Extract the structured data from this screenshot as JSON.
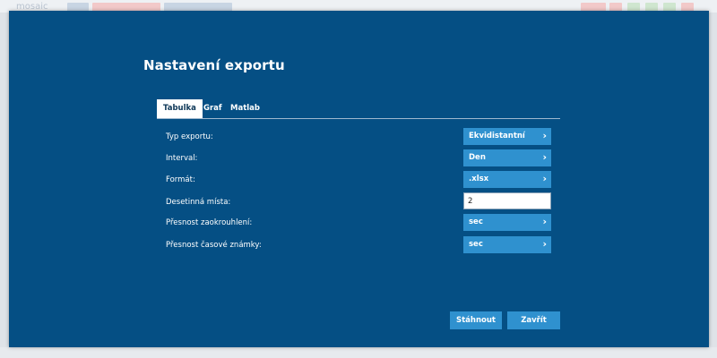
{
  "background": {
    "logo_text": "mosaic"
  },
  "dialog": {
    "title": "Nastavení exportu",
    "tabs": [
      {
        "label": "Tabulka",
        "active": true
      },
      {
        "label": "Graf",
        "active": false
      },
      {
        "label": "Matlab",
        "active": false
      }
    ],
    "fields": {
      "typ_exportu": {
        "label": "Typ exportu:",
        "value": "Ekvidistantní"
      },
      "interval": {
        "label": "Interval:",
        "value": "Den"
      },
      "format": {
        "label": "Formát:",
        "value": ".xlsx"
      },
      "desetinna_mista": {
        "label": "Desetinná místa:",
        "value": "2"
      },
      "presnost_zaokrouhleni": {
        "label": "Přesnost zaokrouhlení:",
        "value": "sec"
      },
      "presnost_casove_znamky": {
        "label": "Přesnost časové známky:",
        "value": "sec"
      }
    },
    "buttons": {
      "download": "Stáhnout",
      "close": "Zavřít"
    }
  },
  "colors": {
    "modal_bg": "#054f84",
    "button_bg": "#2f91cf",
    "text": "#ffffff"
  },
  "icons": {
    "select_chevron": "chevron-right-icon"
  }
}
